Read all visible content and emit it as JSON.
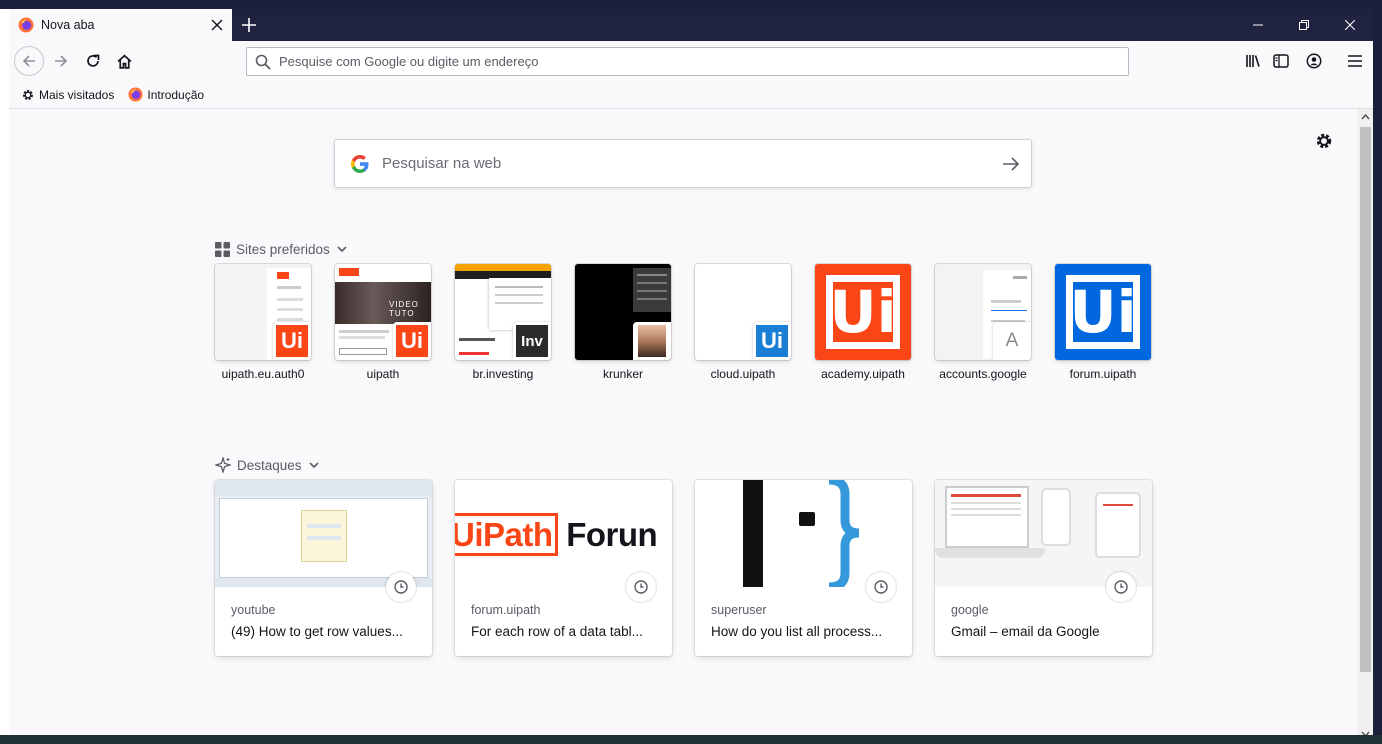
{
  "tab": {
    "title": "Nova aba"
  },
  "urlbar": {
    "placeholder": "Pesquise com Google ou digite um endereço"
  },
  "bookmarks": [
    {
      "label": "Mais visitados",
      "icon": "gear-icon"
    },
    {
      "label": "Introdução",
      "icon": "firefox-icon"
    }
  ],
  "search": {
    "placeholder": "Pesquisar na web"
  },
  "sections": {
    "top_sites": "Sites preferidos",
    "highlights": "Destaques"
  },
  "top_sites": [
    {
      "label": "uipath.eu.auth0"
    },
    {
      "label": "uipath"
    },
    {
      "label": "br.investing"
    },
    {
      "label": "krunker"
    },
    {
      "label": "cloud.uipath"
    },
    {
      "label": "academy.uipath"
    },
    {
      "label": "accounts.google"
    },
    {
      "label": "forum.uipath"
    }
  ],
  "thumb_text": {
    "uipath_video": "VIDEO TUTO",
    "inv_badge": "Inv",
    "ui": "Ui",
    "accounts_badge": "A",
    "forum_logo": "UiPath",
    "forum_logo_rest": "Forun"
  },
  "highlights": [
    {
      "host": "youtube",
      "title": "(49) How to get row values..."
    },
    {
      "host": "forum.uipath",
      "title": "For each row of a data tabl..."
    },
    {
      "host": "superuser",
      "title": "How do you list all process..."
    },
    {
      "host": "google",
      "title": "Gmail – email da Google"
    }
  ],
  "colors": {
    "uipath_orange": "#fa4616",
    "uipath_blue": "#0067df",
    "titlebar": "#202340"
  }
}
